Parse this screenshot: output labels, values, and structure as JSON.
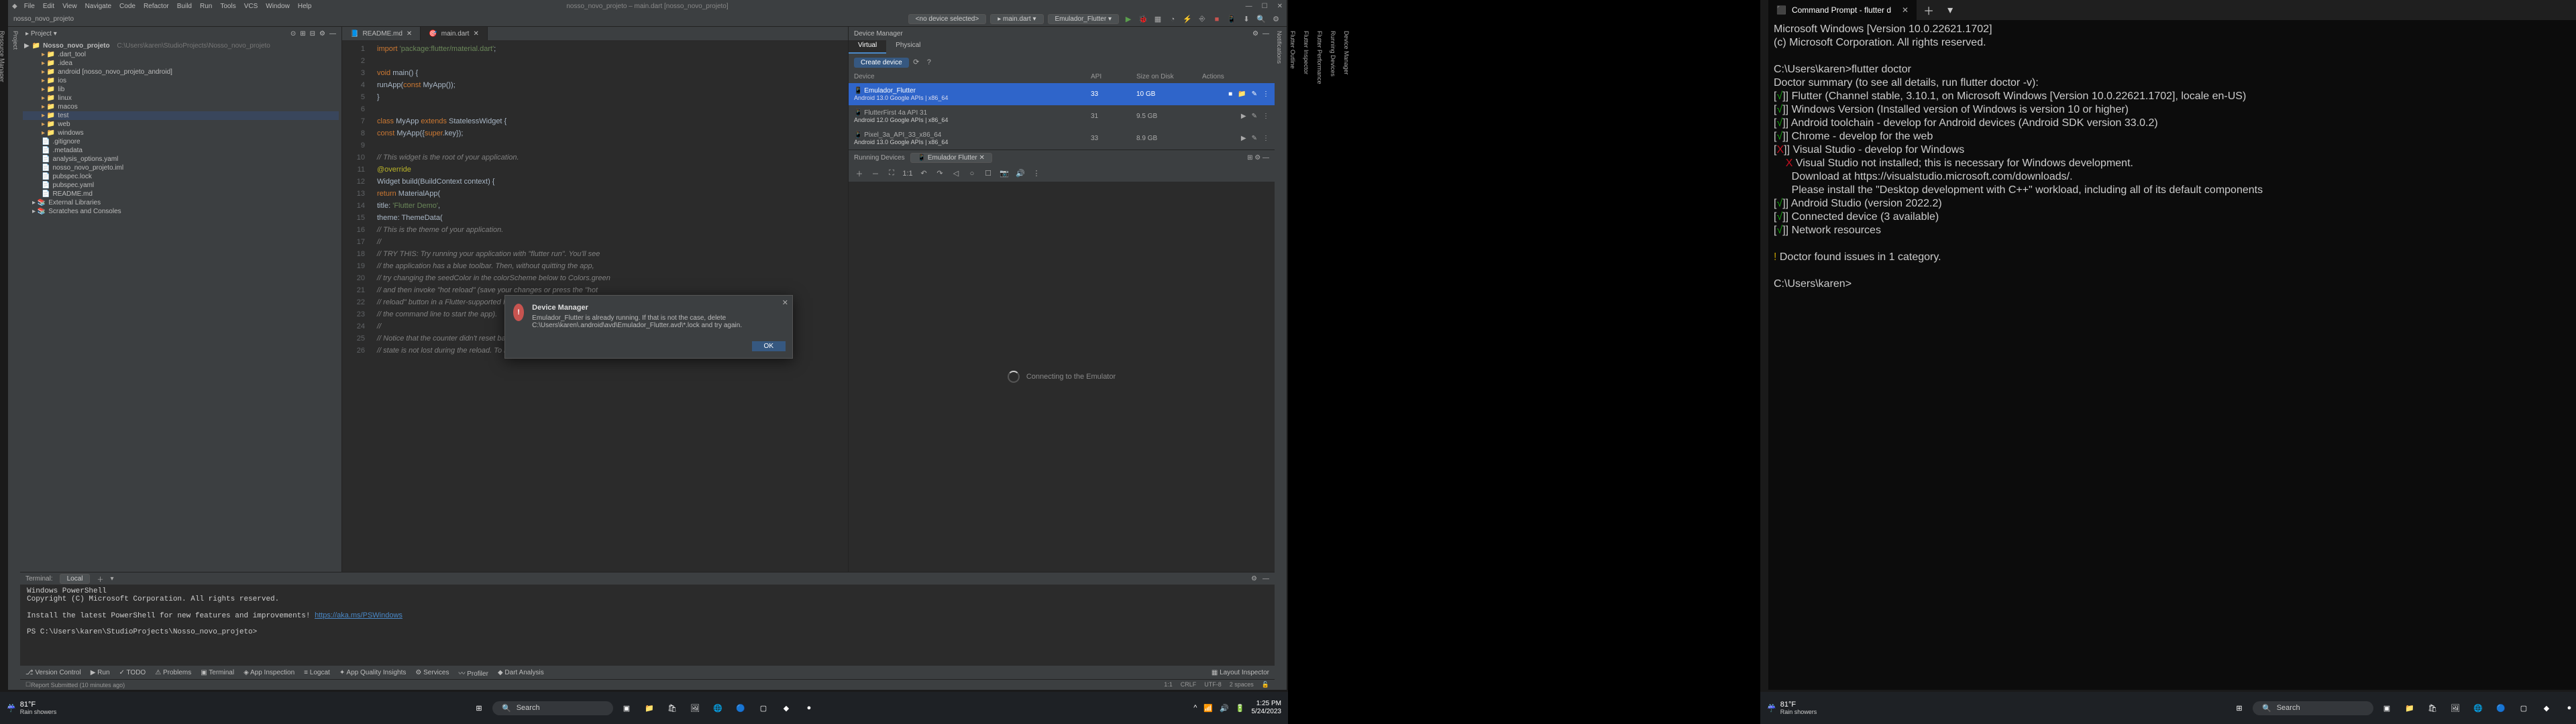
{
  "ide": {
    "menu": [
      "File",
      "Edit",
      "View",
      "Navigate",
      "Code",
      "Refactor",
      "Build",
      "Run",
      "Tools",
      "VCS",
      "Window",
      "Help"
    ],
    "title_project": "nosso_novo_projeto",
    "title_path_hint": "nosso_novo_projeto – main.dart [nosso_novo_projeto]",
    "breadcrumb": "Nosso_novo_projeto  C:\\Users\\karen\\StudioProjects\\Nosso_novo_projeto",
    "toolbar": {
      "device_selector": "<no device selected>",
      "run_config": "main.dart",
      "flutter_selector": "Emulador_Flutter ▾"
    },
    "project_panel": {
      "title": "Project",
      "root": "Nosso_novo_projeto",
      "root_path": "C:\\Users\\karen\\StudioProjects\\Nosso_novo_projeto",
      "nodes": [
        {
          "l": 1,
          "t": "folder",
          "name": ".dart_tool"
        },
        {
          "l": 1,
          "t": "folder",
          "name": ".idea"
        },
        {
          "l": 1,
          "t": "folder",
          "name": "android [nosso_novo_projeto_android]"
        },
        {
          "l": 1,
          "t": "folder",
          "name": "ios"
        },
        {
          "l": 1,
          "t": "folder",
          "name": "lib"
        },
        {
          "l": 1,
          "t": "folder",
          "name": "linux"
        },
        {
          "l": 1,
          "t": "folder",
          "name": "macos"
        },
        {
          "l": 1,
          "t": "folder",
          "name": "test",
          "sel": true
        },
        {
          "l": 1,
          "t": "folder",
          "name": "web"
        },
        {
          "l": 1,
          "t": "folder",
          "name": "windows"
        },
        {
          "l": 1,
          "t": "file",
          "name": ".gitignore"
        },
        {
          "l": 1,
          "t": "file",
          "name": ".metadata"
        },
        {
          "l": 1,
          "t": "file",
          "name": "analysis_options.yaml"
        },
        {
          "l": 1,
          "t": "file",
          "name": "nosso_novo_projeto.iml"
        },
        {
          "l": 1,
          "t": "file",
          "name": "pubspec.lock"
        },
        {
          "l": 1,
          "t": "file",
          "name": "pubspec.yaml"
        },
        {
          "l": 1,
          "t": "file",
          "name": "README.md"
        },
        {
          "l": 0,
          "t": "lib",
          "name": "External Libraries"
        },
        {
          "l": 0,
          "t": "lib",
          "name": "Scratches and Consoles"
        }
      ]
    },
    "tabs": {
      "readme": "README.md",
      "main": "main.dart"
    },
    "code": {
      "start_line": 1,
      "lines": [
        "import 'package:flutter/material.dart';",
        "",
        "void main() {",
        "  runApp(const MyApp());",
        "}",
        "",
        "class MyApp extends StatelessWidget {",
        "  const MyApp({super.key});",
        "",
        "  // This widget is the root of your application.",
        "  @override",
        "  Widget build(BuildContext context) {",
        "    return MaterialApp(",
        "      title: 'Flutter Demo',",
        "      theme: ThemeData(",
        "        // This is the theme of your application.",
        "        //",
        "        // TRY THIS: Try running your application with \"flutter run\". You'll see",
        "        // the application has a blue toolbar. Then, without quitting the app,",
        "        // try changing the seedColor in the colorScheme below to Colors.green",
        "        // and then invoke \"hot reload\" (save your changes or press the \"hot",
        "        // reload\" button in a Flutter-supported IDE, or press \"r\" if you used",
        "        // the command line to start the app).",
        "        //",
        "        // Notice that the counter didn't reset back to zero; the application",
        "        // state is not lost during the reload. To reset the state, use hot"
      ]
    },
    "device_manager": {
      "title": "Device Manager",
      "tabs": {
        "virtual": "Virtual",
        "physical": "Physical"
      },
      "create": "Create device",
      "columns": {
        "device": "Device",
        "api": "API",
        "size": "Size on Disk",
        "actions": "Actions"
      },
      "rows": [
        {
          "name": "Emulador_Flutter",
          "sub": "Android 13.0 Google APIs | x86_64",
          "api": "33",
          "size": "10 GB",
          "sel": true,
          "running": true
        },
        {
          "name": "FlutterFirst 4a API 31",
          "sub": "Android 12.0 Google APIs | x86_64",
          "api": "31",
          "size": "9.5 GB"
        },
        {
          "name": "Pixel_3a_API_33_x86_64",
          "sub": "Android 13.0 Google APIs | x86_64",
          "api": "33",
          "size": "8.9 GB"
        }
      ],
      "running_label": "Running Devices",
      "running_device": "Emulador Flutter",
      "loading": "Connecting to the Emulator"
    },
    "terminal": {
      "title": "Terminal:",
      "session": "Local",
      "lines": [
        "Windows PowerShell",
        "Copyright (C) Microsoft Corporation. All rights reserved.",
        "",
        "Install the latest PowerShell for new features and improvements! https://aka.ms/PSWindows",
        "",
        "PS C:\\Users\\karen\\StudioProjects\\Nosso_novo_projeto> "
      ],
      "link": "https://aka.ms/PSWindows"
    },
    "statusbar": {
      "items": [
        "Version Control",
        "Run",
        "TODO",
        "Problems",
        "Terminal",
        "App Inspection",
        "Logcat",
        "App Quality Insights",
        "Services",
        "Profiler",
        "Dart Analysis"
      ],
      "right": [
        "Layout Inspector"
      ],
      "report": "Report Submitted (10 minutes ago)",
      "cursor": "1:1",
      "le": "CRLF",
      "enc": "UTF-8",
      "indent": "2 spaces"
    },
    "modal": {
      "title": "Device Manager",
      "message": "Emulador_Flutter is already running. If that is not the case, delete C:\\Users\\karen\\.android\\avd\\Emulador_Flutter.avd\\*.lock and try again.",
      "ok": "OK"
    }
  },
  "cmd": {
    "tab_title": "Command Prompt - flutter d",
    "lines": [
      {
        "t": "Microsoft Windows [Version 10.0.22621.1702]"
      },
      {
        "t": "(c) Microsoft Corporation. All rights reserved."
      },
      {
        "t": ""
      },
      {
        "t": "C:\\Users\\karen>flutter doctor"
      },
      {
        "t": "Doctor summary (to see all details, run flutter doctor -v):"
      },
      {
        "p": "[",
        "c": "grn",
        "m": "√",
        "s": "] Flutter (Channel stable, 3.10.1, on Microsoft Windows [Version 10.0.22621.1702], locale en-US)"
      },
      {
        "p": "[",
        "c": "grn",
        "m": "√",
        "s": "] Windows Version (Installed version of Windows is version 10 or higher)"
      },
      {
        "p": "[",
        "c": "grn",
        "m": "√",
        "s": "] Android toolchain - develop for Android devices (Android SDK version 33.0.2)"
      },
      {
        "p": "[",
        "c": "grn",
        "m": "√",
        "s": "] Chrome - develop for the web"
      },
      {
        "p": "[",
        "c": "rd",
        "m": "X",
        "s": "] Visual Studio - develop for Windows"
      },
      {
        "t": "    X Visual Studio not installed; this is necessary for Windows development.",
        "c": "rd-lead"
      },
      {
        "t": "      Download at https://visualstudio.microsoft.com/downloads/."
      },
      {
        "t": "      Please install the \"Desktop development with C++\" workload, including all of its default components"
      },
      {
        "p": "[",
        "c": "grn",
        "m": "√",
        "s": "] Android Studio (version 2022.2)"
      },
      {
        "p": "[",
        "c": "grn",
        "m": "√",
        "s": "] Connected device (3 available)"
      },
      {
        "p": "[",
        "c": "grn",
        "m": "√",
        "s": "] Network resources"
      },
      {
        "t": ""
      },
      {
        "p": "",
        "c": "yel",
        "m": "!",
        "s": " Doctor found issues in 1 category."
      },
      {
        "t": ""
      },
      {
        "t": "C:\\Users\\karen>"
      }
    ]
  },
  "taskbar": {
    "weather_temp": "81°F",
    "weather_desc": "Rain showers",
    "search_placeholder": "Search",
    "time": "1:25 PM",
    "date": "5/24/2023"
  }
}
